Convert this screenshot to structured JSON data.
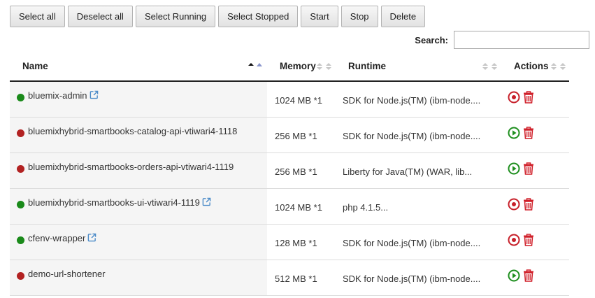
{
  "toolbar": {
    "buttons": [
      "Select all",
      "Deselect all",
      "Select Running",
      "Select Stopped",
      "Start",
      "Stop",
      "Delete"
    ]
  },
  "search": {
    "label": "Search:",
    "value": "",
    "placeholder": ""
  },
  "table": {
    "columns": [
      "Name",
      "Memory",
      "Runtime",
      "Actions"
    ],
    "sorted_by": "Name",
    "rows": [
      {
        "name": "bluemix-admin",
        "status": "running",
        "has_link": true,
        "memory": "1024 MB *1",
        "runtime": "SDK for Node.js(TM) (ibm-node....",
        "action": "stop"
      },
      {
        "name": "bluemixhybrid-smartbooks-catalog-api-vtiwari4-1118",
        "status": "stopped",
        "has_link": false,
        "memory": "256 MB *1",
        "runtime": "SDK for Node.js(TM) (ibm-node....",
        "action": "start"
      },
      {
        "name": "bluemixhybrid-smartbooks-orders-api-vtiwari4-1119",
        "status": "stopped",
        "has_link": false,
        "memory": "256 MB *1",
        "runtime": "Liberty for Java(TM) (WAR, lib...",
        "action": "start"
      },
      {
        "name": "bluemixhybrid-smartbooks-ui-vtiwari4-1119",
        "status": "running",
        "has_link": true,
        "memory": "1024 MB *1",
        "runtime": "php 4.1.5...",
        "action": "stop"
      },
      {
        "name": "cfenv-wrapper",
        "status": "running",
        "has_link": true,
        "memory": "128 MB *1",
        "runtime": "SDK for Node.js(TM) (ibm-node....",
        "action": "stop"
      },
      {
        "name": "demo-url-shortener",
        "status": "stopped",
        "has_link": false,
        "memory": "512 MB *1",
        "runtime": "SDK for Node.js(TM) (ibm-node....",
        "action": "start"
      }
    ]
  },
  "colors": {
    "running_dot": "#1a8a1a",
    "stopped_dot": "#b22222",
    "stop_icon": "#c7202a",
    "start_icon": "#1f8f1f",
    "delete_icon": "#d0202a",
    "link_icon": "#4a8ac8"
  },
  "icons": {
    "link": "external-link-icon",
    "stop": "stop-circle-icon",
    "start": "play-circle-icon",
    "delete": "trash-icon"
  }
}
